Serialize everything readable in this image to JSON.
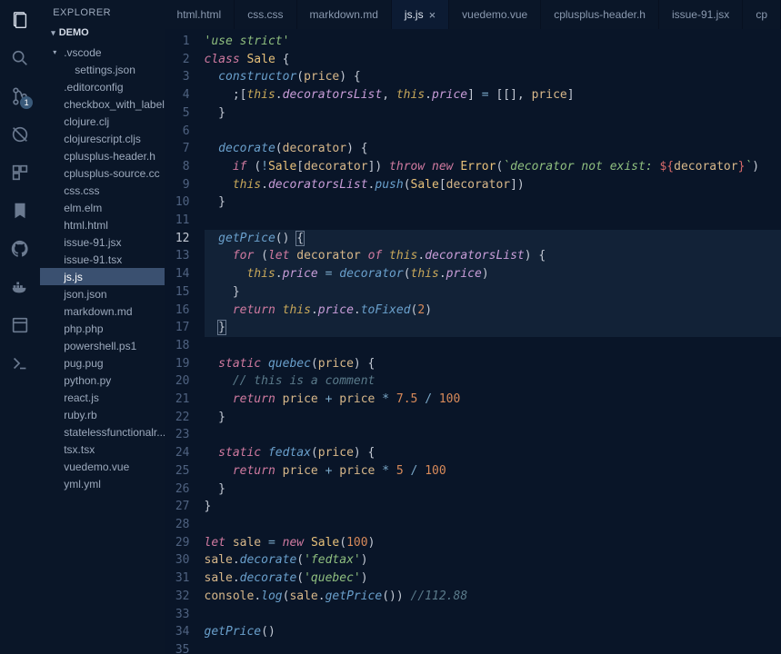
{
  "explorer": {
    "title": "EXPLORER",
    "folder": "DEMO",
    "items": [
      {
        "label": ".vscode",
        "type": "folder",
        "depth": 1
      },
      {
        "label": "settings.json",
        "depth": 2
      },
      {
        "label": ".editorconfig",
        "depth": 1
      },
      {
        "label": "checkbox_with_label...",
        "depth": 1
      },
      {
        "label": "clojure.clj",
        "depth": 1
      },
      {
        "label": "clojurescript.cljs",
        "depth": 1
      },
      {
        "label": "cplusplus-header.h",
        "depth": 1
      },
      {
        "label": "cplusplus-source.cc",
        "depth": 1
      },
      {
        "label": "css.css",
        "depth": 1
      },
      {
        "label": "elm.elm",
        "depth": 1
      },
      {
        "label": "html.html",
        "depth": 1
      },
      {
        "label": "issue-91.jsx",
        "depth": 1
      },
      {
        "label": "issue-91.tsx",
        "depth": 1
      },
      {
        "label": "js.js",
        "depth": 1,
        "selected": true
      },
      {
        "label": "json.json",
        "depth": 1
      },
      {
        "label": "markdown.md",
        "depth": 1
      },
      {
        "label": "php.php",
        "depth": 1
      },
      {
        "label": "powershell.ps1",
        "depth": 1
      },
      {
        "label": "pug.pug",
        "depth": 1
      },
      {
        "label": "python.py",
        "depth": 1
      },
      {
        "label": "react.js",
        "depth": 1
      },
      {
        "label": "ruby.rb",
        "depth": 1
      },
      {
        "label": "statelessfunctionalr...",
        "depth": 1
      },
      {
        "label": "tsx.tsx",
        "depth": 1
      },
      {
        "label": "vuedemo.vue",
        "depth": 1
      },
      {
        "label": "yml.yml",
        "depth": 1
      }
    ]
  },
  "tabs": [
    {
      "label": "html.html"
    },
    {
      "label": "css.css"
    },
    {
      "label": "markdown.md"
    },
    {
      "label": "js.js",
      "active": true,
      "closeable": true
    },
    {
      "label": "vuedemo.vue"
    },
    {
      "label": "cplusplus-header.h"
    },
    {
      "label": "issue-91.jsx"
    },
    {
      "label": "cp"
    }
  ],
  "activity_badge": "1",
  "editor": {
    "current_line": 12,
    "lines": [
      {
        "n": 1,
        "html": "<span class='tk-str'>'use strict'</span>"
      },
      {
        "n": 2,
        "html": "<span class='tk-kw'>class</span> <span class='tk-cls'>Sale</span> <span class='tk-pun'>{</span>"
      },
      {
        "n": 3,
        "html": "  <span class='tk-fn'>constructor</span><span class='tk-pun'>(</span><span class='tk-var'>price</span><span class='tk-pun'>) {</span>"
      },
      {
        "n": 4,
        "html": "    <span class='tk-pun'>;[</span><span class='tk-this'>this</span><span class='tk-pun'>.</span><span class='tk-prop'>decoratorsList</span><span class='tk-pun'>, </span><span class='tk-this'>this</span><span class='tk-pun'>.</span><span class='tk-prop'>price</span><span class='tk-pun'>] </span><span class='tk-op'>=</span><span class='tk-pun'> [[], </span><span class='tk-var'>price</span><span class='tk-pun'>]</span>"
      },
      {
        "n": 5,
        "html": "  <span class='tk-pun'>}</span>"
      },
      {
        "n": 6,
        "html": ""
      },
      {
        "n": 7,
        "html": "  <span class='tk-fn'>decorate</span><span class='tk-pun'>(</span><span class='tk-var'>decorator</span><span class='tk-pun'>) {</span>"
      },
      {
        "n": 8,
        "html": "    <span class='tk-kw'>if</span> <span class='tk-pun'>(</span><span class='tk-op'>!</span><span class='tk-cls'>Sale</span><span class='tk-pun'>[</span><span class='tk-var'>decorator</span><span class='tk-pun'>]) </span><span class='tk-kw'>throw</span> <span class='tk-kw'>new</span> <span class='tk-cls'>Error</span><span class='tk-pun'>(</span><span class='tk-str'>`decorator not exist: </span><span class='tk-err'>${</span><span class='tk-var'>decorator</span><span class='tk-err'>}</span><span class='tk-str'>`</span><span class='tk-pun'>)</span>"
      },
      {
        "n": 9,
        "html": "    <span class='tk-this'>this</span><span class='tk-pun'>.</span><span class='tk-prop'>decoratorsList</span><span class='tk-pun'>.</span><span class='tk-fn'>push</span><span class='tk-pun'>(</span><span class='tk-cls'>Sale</span><span class='tk-pun'>[</span><span class='tk-var'>decorator</span><span class='tk-pun'>])</span>"
      },
      {
        "n": 10,
        "html": "  <span class='tk-pun'>}</span>"
      },
      {
        "n": 11,
        "html": ""
      },
      {
        "n": 12,
        "html": "  <span class='tk-fn'>getPrice</span><span class='tk-pun'>() </span><span class='tk-pun cursor-box'>{</span>",
        "hl": true
      },
      {
        "n": 13,
        "html": "    <span class='tk-kw'>for</span> <span class='tk-pun'>(</span><span class='tk-kw'>let</span> <span class='tk-var'>decorator</span> <span class='tk-kw'>of</span> <span class='tk-this'>this</span><span class='tk-pun'>.</span><span class='tk-prop'>decoratorsList</span><span class='tk-pun'>) {</span>",
        "hl": true
      },
      {
        "n": 14,
        "html": "      <span class='tk-this'>this</span><span class='tk-pun'>.</span><span class='tk-prop'>price</span> <span class='tk-op'>=</span> <span class='tk-fn'>decorator</span><span class='tk-pun'>(</span><span class='tk-this'>this</span><span class='tk-pun'>.</span><span class='tk-prop'>price</span><span class='tk-pun'>)</span>",
        "hl": true
      },
      {
        "n": 15,
        "html": "    <span class='tk-pun'>}</span>",
        "hl": true
      },
      {
        "n": 16,
        "html": "    <span class='tk-kw'>return</span> <span class='tk-this'>this</span><span class='tk-pun'>.</span><span class='tk-prop'>price</span><span class='tk-pun'>.</span><span class='tk-fn'>toFixed</span><span class='tk-pun'>(</span><span class='tk-num'>2</span><span class='tk-pun'>)</span>",
        "hl": true
      },
      {
        "n": 17,
        "html": "  <span class='tk-pun cursor-box'>}</span>",
        "hl": true
      },
      {
        "n": 18,
        "html": ""
      },
      {
        "n": 19,
        "html": "  <span class='tk-kw'>static</span> <span class='tk-fn'>quebec</span><span class='tk-pun'>(</span><span class='tk-var'>price</span><span class='tk-pun'>) {</span>"
      },
      {
        "n": 20,
        "html": "    <span class='tk-cmt'>// this is a comment</span>"
      },
      {
        "n": 21,
        "html": "    <span class='tk-kw'>return</span> <span class='tk-var'>price</span> <span class='tk-op'>+</span> <span class='tk-var'>price</span> <span class='tk-op'>*</span> <span class='tk-num'>7.5</span> <span class='tk-op'>/</span> <span class='tk-num'>100</span>"
      },
      {
        "n": 22,
        "html": "  <span class='tk-pun'>}</span>"
      },
      {
        "n": 23,
        "html": ""
      },
      {
        "n": 24,
        "html": "  <span class='tk-kw'>static</span> <span class='tk-fn'>fedtax</span><span class='tk-pun'>(</span><span class='tk-var'>price</span><span class='tk-pun'>) {</span>"
      },
      {
        "n": 25,
        "html": "    <span class='tk-kw'>return</span> <span class='tk-var'>price</span> <span class='tk-op'>+</span> <span class='tk-var'>price</span> <span class='tk-op'>*</span> <span class='tk-num'>5</span> <span class='tk-op'>/</span> <span class='tk-num'>100</span>"
      },
      {
        "n": 26,
        "html": "  <span class='tk-pun'>}</span>"
      },
      {
        "n": 27,
        "html": "<span class='tk-pun'>}</span>"
      },
      {
        "n": 28,
        "html": ""
      },
      {
        "n": 29,
        "html": "<span class='tk-kw'>let</span> <span class='tk-var'>sale</span> <span class='tk-op'>=</span> <span class='tk-kw'>new</span> <span class='tk-cls'>Sale</span><span class='tk-pun'>(</span><span class='tk-num'>100</span><span class='tk-pun'>)</span>"
      },
      {
        "n": 30,
        "html": "<span class='tk-var'>sale</span><span class='tk-pun'>.</span><span class='tk-fn'>decorate</span><span class='tk-pun'>(</span><span class='tk-str'>'fedtax'</span><span class='tk-pun'>)</span>"
      },
      {
        "n": 31,
        "html": "<span class='tk-var'>sale</span><span class='tk-pun'>.</span><span class='tk-fn'>decorate</span><span class='tk-pun'>(</span><span class='tk-str'>'quebec'</span><span class='tk-pun'>)</span>"
      },
      {
        "n": 32,
        "html": "<span class='tk-var'>console</span><span class='tk-pun'>.</span><span class='tk-fn'>log</span><span class='tk-pun'>(</span><span class='tk-var'>sale</span><span class='tk-pun'>.</span><span class='tk-fn'>getPrice</span><span class='tk-pun'>()) </span><span class='tk-cmt'>//112.88</span>"
      },
      {
        "n": 33,
        "html": ""
      },
      {
        "n": 34,
        "html": "<span class='tk-fn'>getPrice</span><span class='tk-pun'>()</span>"
      },
      {
        "n": 35,
        "html": ""
      }
    ]
  }
}
